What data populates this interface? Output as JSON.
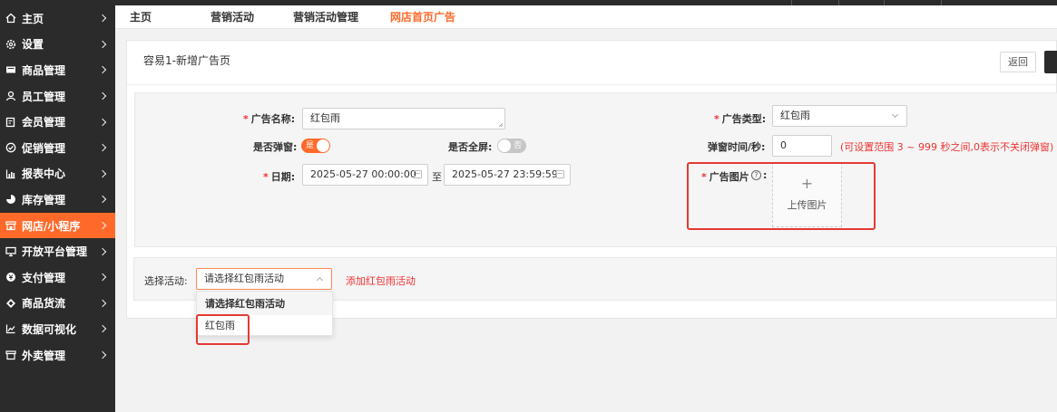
{
  "sidebar": {
    "items": [
      {
        "label": "主页",
        "icon": "home-icon"
      },
      {
        "label": "设置",
        "icon": "gear-icon"
      },
      {
        "label": "商品管理",
        "icon": "product-icon"
      },
      {
        "label": "员工管理",
        "icon": "staff-icon"
      },
      {
        "label": "会员管理",
        "icon": "member-icon"
      },
      {
        "label": "促销管理",
        "icon": "promo-icon"
      },
      {
        "label": "报表中心",
        "icon": "chart-icon"
      },
      {
        "label": "库存管理",
        "icon": "inventory-icon"
      },
      {
        "label": "网店/小程序",
        "icon": "store-icon"
      },
      {
        "label": "开放平台管理",
        "icon": "monitor-icon"
      },
      {
        "label": "支付管理",
        "icon": "payment-icon"
      },
      {
        "label": "商品货流",
        "icon": "flow-icon"
      },
      {
        "label": "数据可视化",
        "icon": "analytics-icon"
      },
      {
        "label": "外卖管理",
        "icon": "takeout-icon"
      }
    ],
    "active_index": 8
  },
  "tabs": [
    {
      "label": "主页"
    },
    {
      "label": "营销活动"
    },
    {
      "label": "营销活动管理"
    },
    {
      "label": "网店首页广告"
    }
  ],
  "header": {
    "title": "容易1-新增广告页",
    "back_label": "返回"
  },
  "form": {
    "ad_name_label": "广告名称:",
    "ad_name_value": "红包雨",
    "ad_type_label": "广告类型:",
    "ad_type_value": "红包雨",
    "popup_label": "是否弹窗:",
    "popup_on": true,
    "popup_text": "是",
    "fullscreen_label": "是否全屏:",
    "fullscreen_on": false,
    "fullscreen_text": "否",
    "popup_time_label": "弹窗时间/秒:",
    "popup_time_value": "0",
    "popup_time_hint": "(可设置范围 3 ~ 999 秒之间,0表示不关闭弹窗)",
    "date_label": "日期:",
    "date_start": "2025-05-27 00:00:00",
    "date_sep": "至",
    "date_end": "2025-05-27 23:59:59",
    "ad_image_label": "广告图片",
    "ad_image_colon": ":",
    "upload_label": "上传图片"
  },
  "activity": {
    "label": "选择活动:",
    "selected": "请选择红包雨活动",
    "add_link": "添加红包雨活动",
    "options": [
      "请选择红包雨活动",
      "红包雨"
    ]
  },
  "colors": {
    "accent": "#ff6a2b",
    "sidebar_bg": "#2b2b2b",
    "highlight_box": "#e53935",
    "required": "#ee3333"
  }
}
